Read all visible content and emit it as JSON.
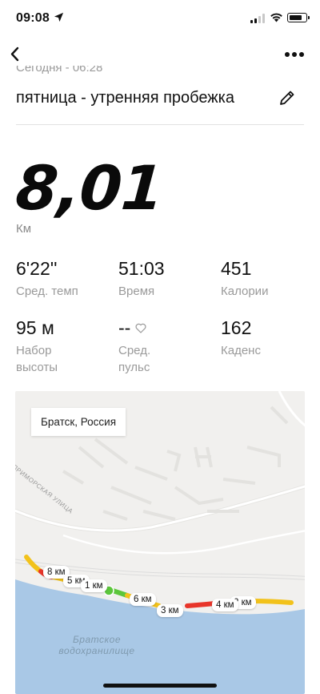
{
  "status_bar": {
    "time": "09:08"
  },
  "header": {
    "date": "Сегодня - 06:28",
    "title": "пятница - утренняя пробежка"
  },
  "distance": {
    "value": "8,01",
    "unit": "Км"
  },
  "stats": [
    {
      "value": "6'22''",
      "label": "Сред. темп"
    },
    {
      "value": "51:03",
      "label": "Время"
    },
    {
      "value": "451",
      "label": "Калории"
    },
    {
      "value": "95 м",
      "label": "Набор высоты"
    },
    {
      "value": "--",
      "label": "Сред. пульс"
    },
    {
      "value": "162",
      "label": "Каденс"
    }
  ],
  "map": {
    "location": "Братск, Россия",
    "street": "ПРИМОРСКАЯ УЛИЦА",
    "lake": "Братское водохранилище",
    "km_markers": [
      "8 км",
      "5 км",
      "1 км",
      "6 км",
      "3 км",
      "4 км",
      "2 км"
    ]
  },
  "colors": {
    "route_slow": "#e8352a",
    "route_mid": "#f2c21b",
    "route_fast": "#5cc63b",
    "water": "#a9c8e6"
  }
}
